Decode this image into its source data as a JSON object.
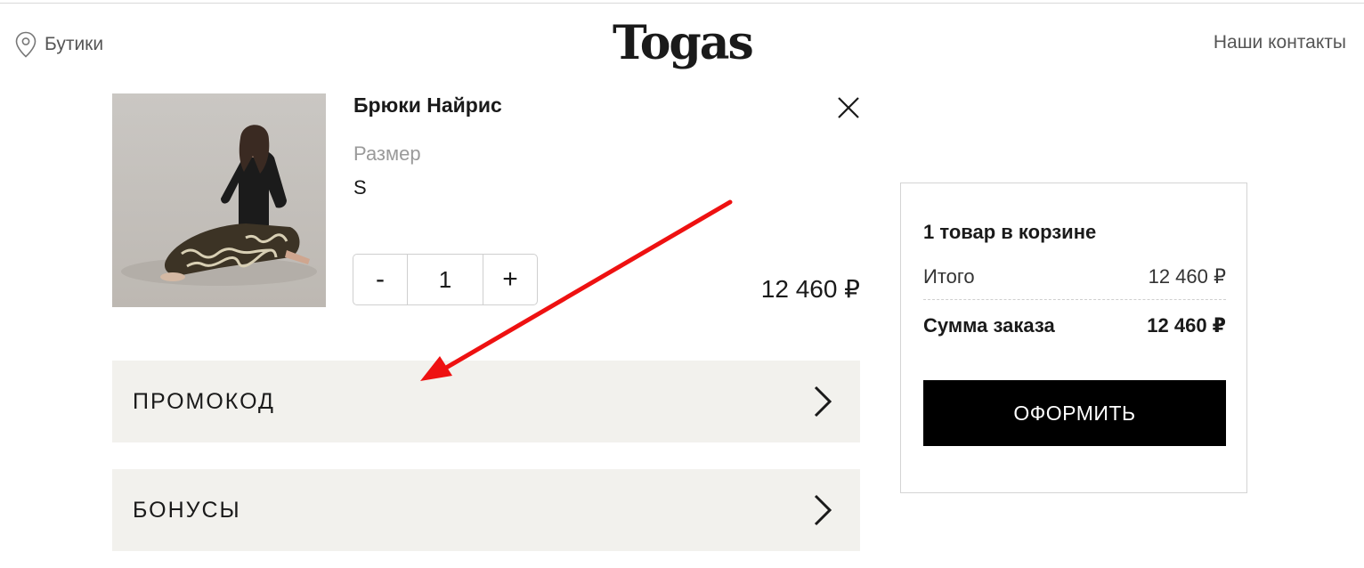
{
  "header": {
    "boutiques_label": "Бутики",
    "logo_text": "Togas",
    "contacts_label": "Наши контакты"
  },
  "product": {
    "name": "Брюки Найрис",
    "size_label": "Размер",
    "size_value": "S",
    "quantity": "1",
    "minus_label": "-",
    "plus_label": "+",
    "price": "12 460 ₽"
  },
  "accordions": {
    "promo_label": "ПРОМОКОД",
    "bonus_label": "БОНУСЫ"
  },
  "summary": {
    "count_text": "1 товар в корзине",
    "total_label": "Итого",
    "total_value": "12 460 ₽",
    "order_label": "Сумма заказа",
    "order_value": "12 460 ₽",
    "checkout_label": "ОФОРМИТЬ"
  },
  "colors": {
    "accent_arrow": "#ee1111",
    "panel_bg": "#f2f1ed",
    "button_bg": "#000000"
  },
  "icons": [
    "location-pin-icon",
    "close-icon",
    "chevron-right-icon"
  ]
}
